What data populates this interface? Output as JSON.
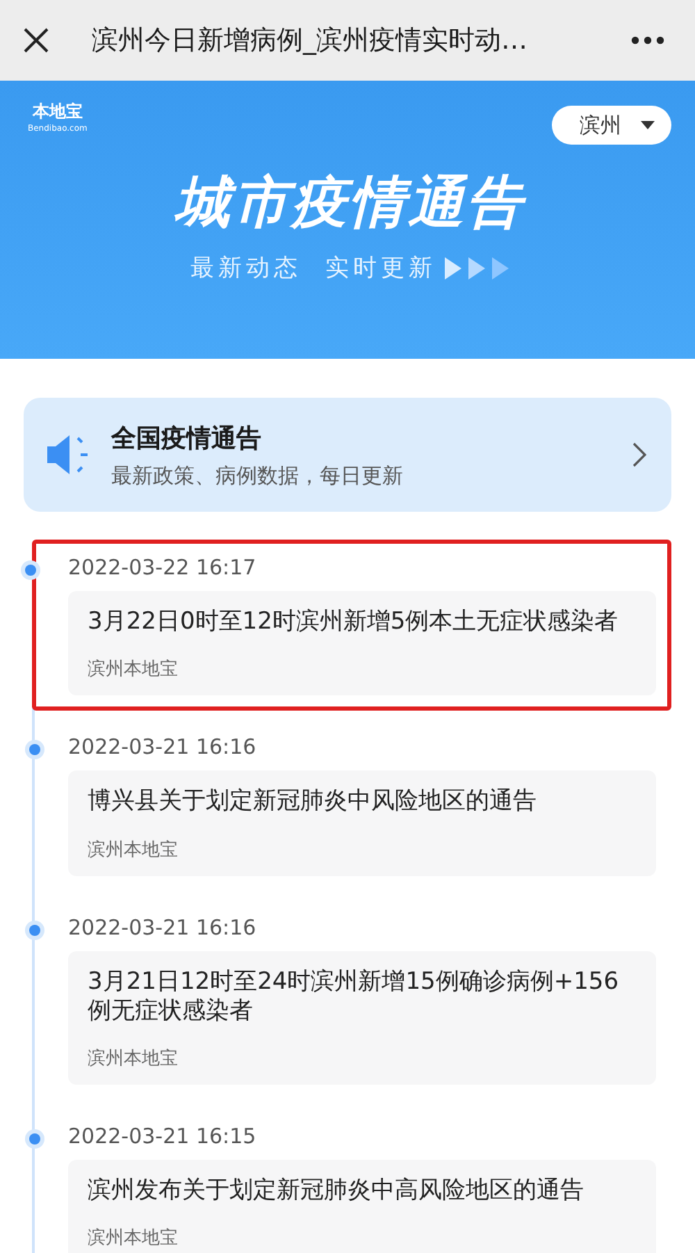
{
  "window": {
    "title": "滨州今日新增病例_滨州疫情实时动…"
  },
  "banner": {
    "logo": {
      "name": "本地宝",
      "domain": "Bendibao.com"
    },
    "city": "滨州",
    "title": "城市疫情通告",
    "subtitle": "最新动态  实时更新"
  },
  "notice": {
    "title": "全国疫情通告",
    "subtitle": "最新政策、病例数据，每日更新"
  },
  "items": [
    {
      "time": "2022-03-22 16:17",
      "title": "3月22日0时至12时滨州新增5例本土无症状感染者",
      "source": "滨州本地宝",
      "highlighted": true
    },
    {
      "time": "2022-03-21 16:16",
      "title": "博兴县关于划定新冠肺炎中风险地区的通告",
      "source": "滨州本地宝",
      "highlighted": false
    },
    {
      "time": "2022-03-21 16:16",
      "title": "3月21日12时至24时滨州新增15例确诊病例+156例无症状感染者",
      "source": "滨州本地宝",
      "highlighted": false
    },
    {
      "time": "2022-03-21 16:15",
      "title": "滨州发布关于划定新冠肺炎中高风险地区的通告",
      "source": "滨州本地宝",
      "highlighted": false
    }
  ]
}
